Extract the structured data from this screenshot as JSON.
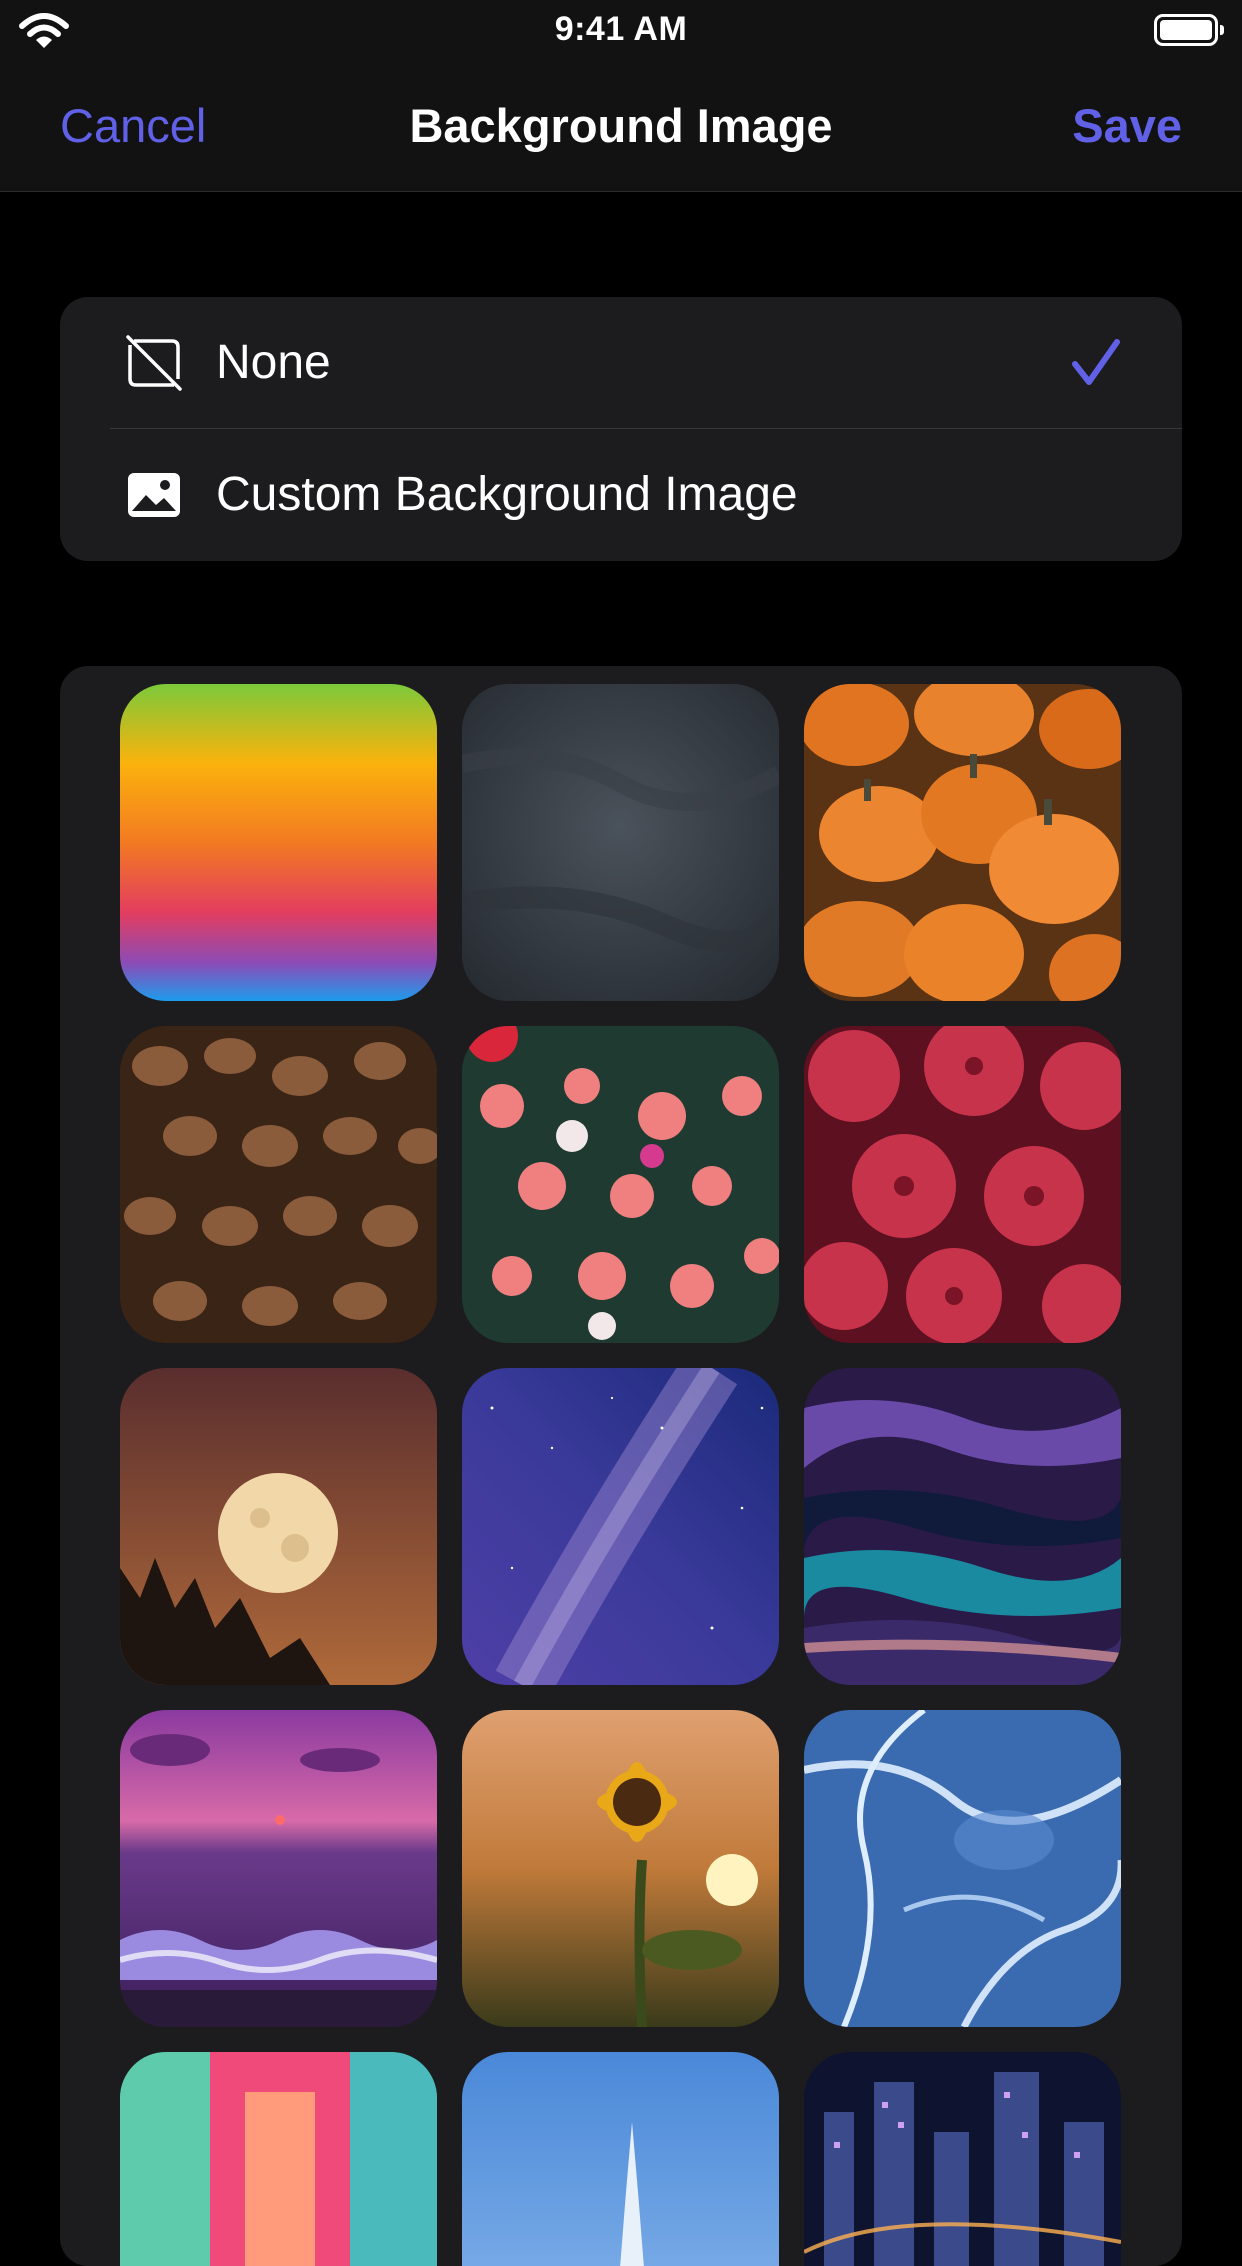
{
  "status_bar": {
    "time": "9:41 AM"
  },
  "nav": {
    "cancel_label": "Cancel",
    "title": "Background Image",
    "save_label": "Save"
  },
  "options": {
    "none_label": "None",
    "custom_label": "Custom Background Image",
    "selected": "None"
  },
  "accent_color": "#6161e8",
  "grid": {
    "tiles": [
      {
        "name": "rainbow-gradient",
        "row": 1,
        "col": 1
      },
      {
        "name": "slate-texture",
        "row": 1,
        "col": 2
      },
      {
        "name": "pumpkins",
        "row": 1,
        "col": 3
      },
      {
        "name": "coffee-beans",
        "row": 2,
        "col": 1
      },
      {
        "name": "flower-bush",
        "row": 2,
        "col": 2
      },
      {
        "name": "red-chrysanthemums",
        "row": 2,
        "col": 3
      },
      {
        "name": "full-moon",
        "row": 3,
        "col": 1
      },
      {
        "name": "milky-way",
        "row": 3,
        "col": 2
      },
      {
        "name": "fluid-art",
        "row": 3,
        "col": 3
      },
      {
        "name": "purple-sunset-sea",
        "row": 4,
        "col": 1
      },
      {
        "name": "sunflower",
        "row": 4,
        "col": 2
      },
      {
        "name": "blue-ice",
        "row": 4,
        "col": 3
      },
      {
        "name": "neon-corridor",
        "row": 5,
        "col": 1
      },
      {
        "name": "blue-sky-tower",
        "row": 5,
        "col": 2
      },
      {
        "name": "night-city",
        "row": 5,
        "col": 3
      }
    ]
  }
}
